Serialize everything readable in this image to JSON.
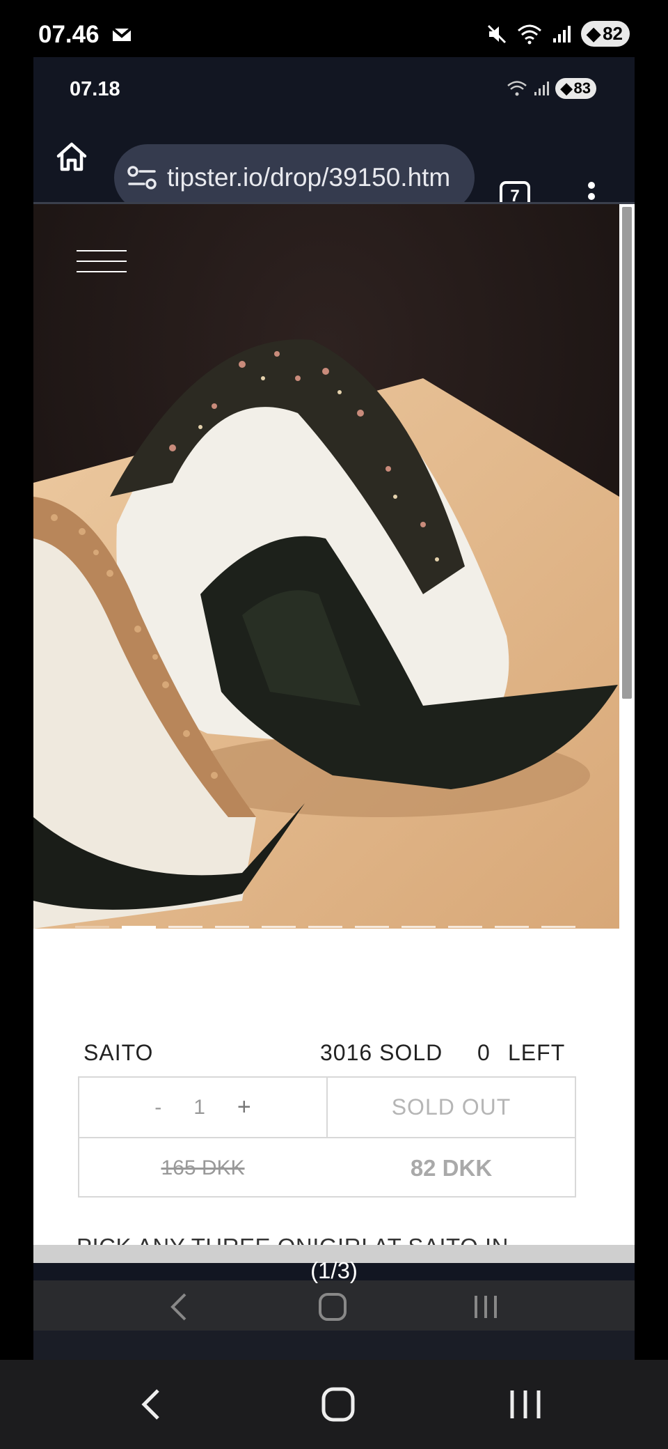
{
  "device_status": {
    "time": "07.46",
    "battery": "82",
    "icons": [
      "mail-icon",
      "mute-icon",
      "wifi-icon",
      "signal-icon",
      "battery-icon"
    ]
  },
  "inner_status": {
    "time": "07.18",
    "battery": "83"
  },
  "browser": {
    "url": "tipster.io/drop/39150.htm",
    "tab_count": "7"
  },
  "carousel": {
    "slide_count": 11,
    "active_index": 1
  },
  "product": {
    "name": "SAITO",
    "sold": "3016 SOLD",
    "left_count": "0",
    "left_label": "LEFT",
    "qty_minus": "-",
    "qty_value": "1",
    "qty_plus": "+",
    "button_label": "SOLD OUT",
    "original_price": "165 DKK",
    "price": "82 DKK",
    "description": "PICK ANY THREE ONIGIRI AT SAITO IN"
  },
  "overlay": {
    "counter": "(1/3)"
  },
  "colors": {
    "browser_bg": "#121622",
    "url_bg": "#353b4e",
    "border": "#d8d8d8"
  }
}
